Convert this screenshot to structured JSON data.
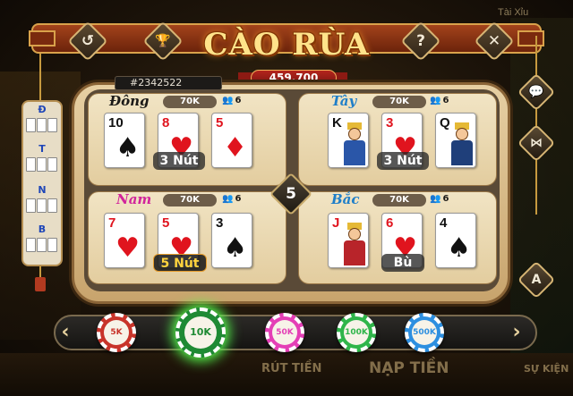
{
  "background": {
    "tai_xiu_label": "Tài Xỉu",
    "bottom_left": "RÚT TIỀN",
    "bottom_center": "NẠP TIỀN",
    "bottom_right": "SỰ KIỆN"
  },
  "header": {
    "title": "CÀO RÙA",
    "pot": "459.700",
    "room_id": "#2342522"
  },
  "top_buttons": [
    {
      "name": "back-icon",
      "glyph": "↺"
    },
    {
      "name": "trophy-icon",
      "glyph": "🏆"
    },
    {
      "name": "help-icon",
      "glyph": "?"
    },
    {
      "name": "close-icon",
      "glyph": "✕"
    }
  ],
  "center_count": "5",
  "seats": [
    {
      "name": "Đông",
      "bet": "70K",
      "players": "6",
      "result": "3 Nút",
      "cards": [
        {
          "rank": "10",
          "suit": "♠",
          "color": "#111"
        },
        {
          "rank": "8",
          "suit": "♥",
          "color": "#e0141e"
        },
        {
          "rank": "5",
          "suit": "♦",
          "color": "#e0141e"
        }
      ]
    },
    {
      "name": "Tây",
      "bet": "70K",
      "players": "6",
      "result": "3 Nút",
      "cards": [
        {
          "rank": "K",
          "suit": "♣",
          "color": "#111"
        },
        {
          "rank": "3",
          "suit": "♥",
          "color": "#e0141e"
        },
        {
          "rank": "Q",
          "suit": "♠",
          "color": "#111"
        }
      ]
    },
    {
      "name": "Nam",
      "bet": "70K",
      "players": "6",
      "result": "5 Nút",
      "cards": [
        {
          "rank": "7",
          "suit": "♥",
          "color": "#e0141e"
        },
        {
          "rank": "5",
          "suit": "♥",
          "color": "#e0141e"
        },
        {
          "rank": "3",
          "suit": "♠",
          "color": "#111"
        }
      ]
    },
    {
      "name": "Bắc",
      "bet": "70K",
      "players": "6",
      "result": "Bù",
      "cards": [
        {
          "rank": "J",
          "suit": "♥",
          "color": "#e0141e"
        },
        {
          "rank": "6",
          "suit": "♥",
          "color": "#e0141e"
        },
        {
          "rank": "4",
          "suit": "♠",
          "color": "#111"
        }
      ]
    }
  ],
  "scoreboard": {
    "letters": [
      "Đ",
      "T",
      "N",
      "B"
    ]
  },
  "side_buttons": [
    {
      "name": "chat-icon",
      "glyph": "💬"
    },
    {
      "name": "share-icon",
      "glyph": "⋈"
    },
    {
      "name": "auto-icon",
      "glyph": "A"
    }
  ],
  "chips": [
    {
      "label": "5K",
      "color": "#c8342a",
      "selected": false
    },
    {
      "label": "10K",
      "color": "#1f8a34",
      "selected": true
    },
    {
      "label": "50K",
      "color": "#e43fb6",
      "selected": false
    },
    {
      "label": "100K",
      "color": "#2fb54a",
      "selected": false
    },
    {
      "label": "500K",
      "color": "#2d8fe0",
      "selected": false
    }
  ],
  "colors": {
    "dong": "#1c1a18",
    "tay": "#1e7ec9",
    "nam": "#d1249b",
    "bac": "#1e7ec9"
  }
}
